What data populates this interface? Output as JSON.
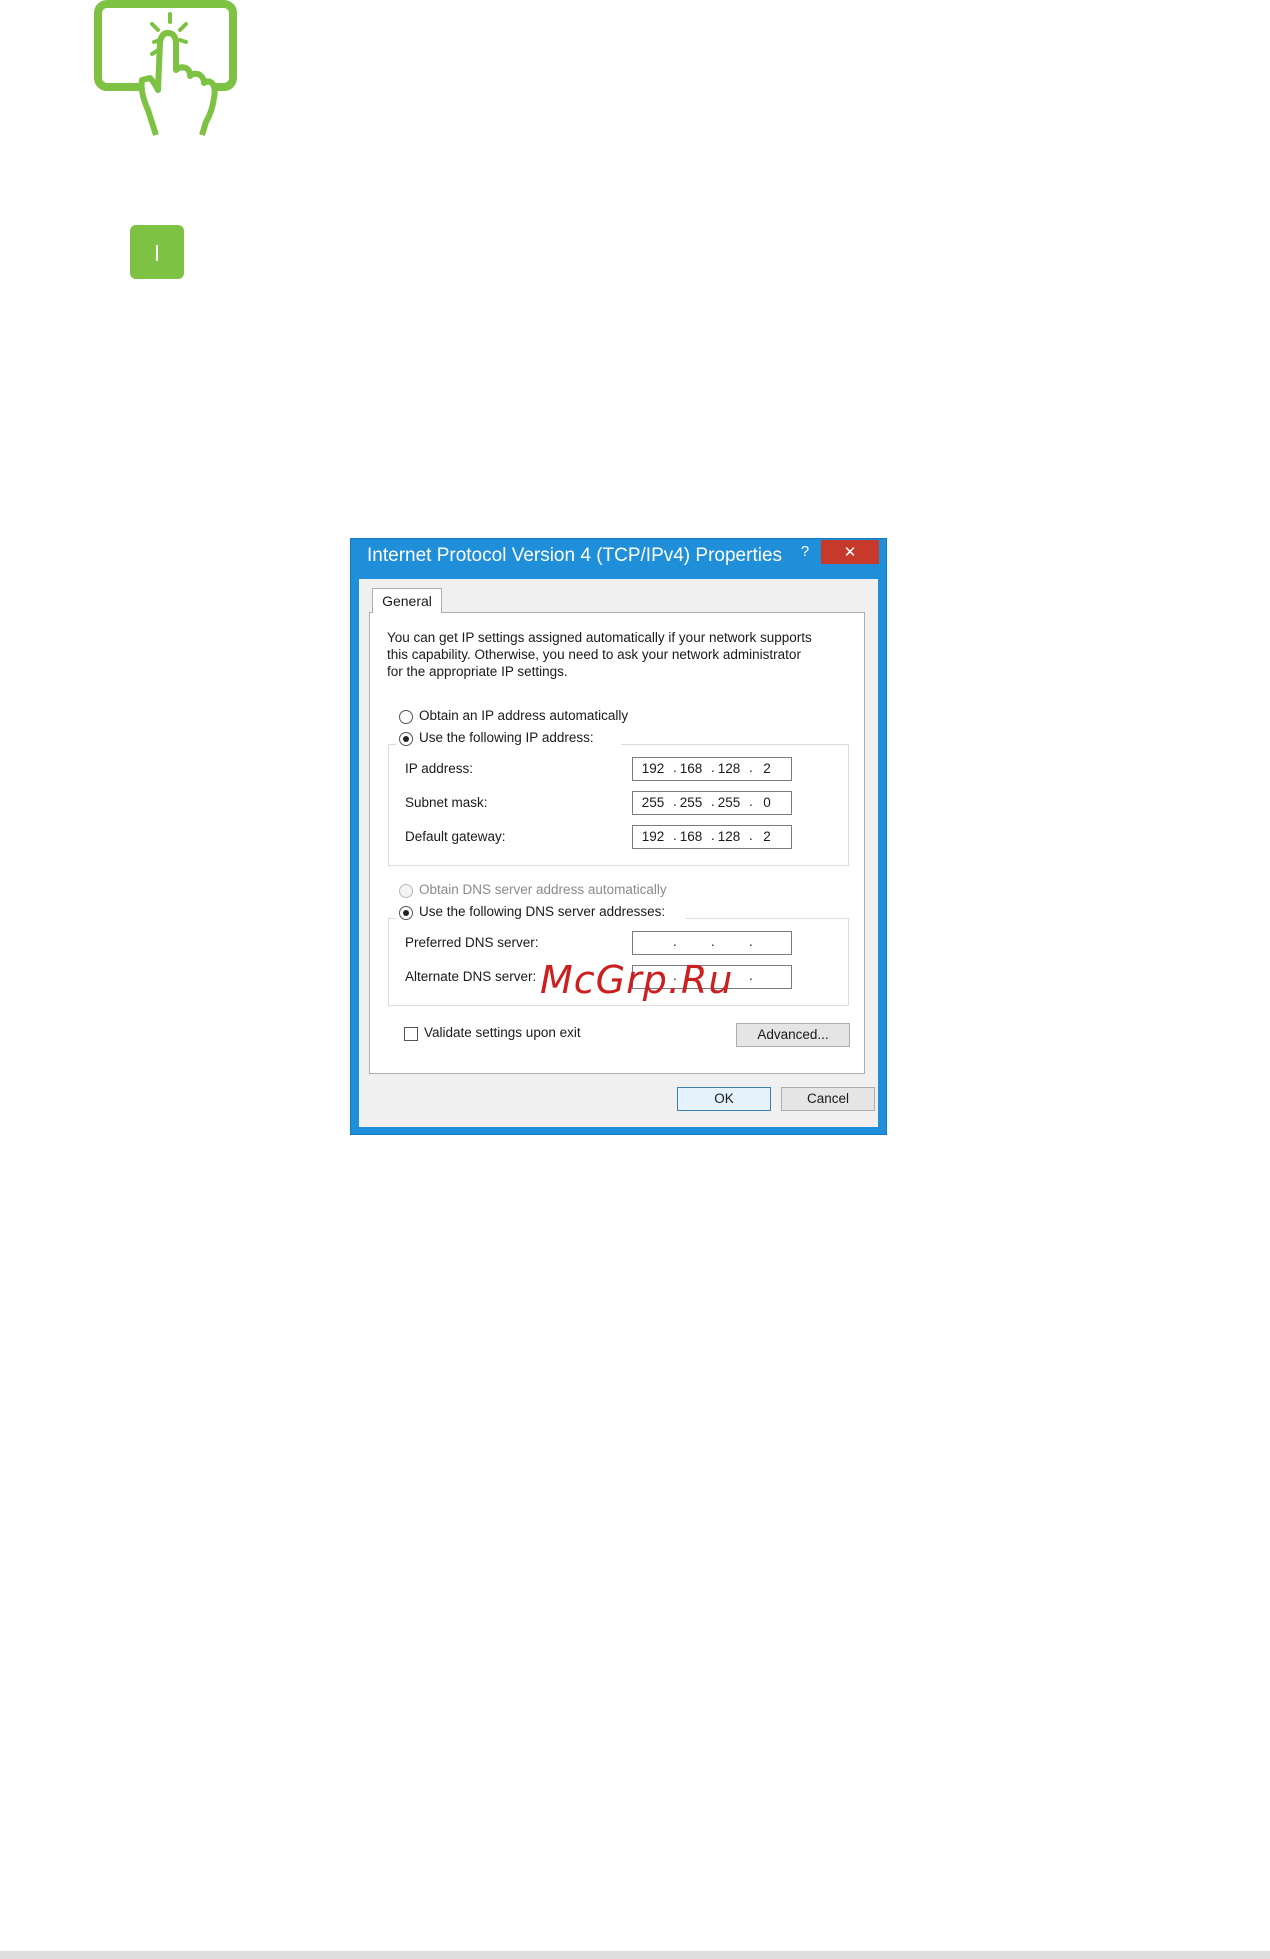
{
  "step_badge": {
    "text": "l"
  },
  "dialog": {
    "title": "Internet Protocol Version 4 (TCP/IPv4) Properties",
    "help_label": "?",
    "close_label": "✕",
    "tab_label": "General",
    "intro_text": "You can get IP settings assigned automatically if your network supports\nthis capability. Otherwise, you need to ask your network administrator\nfor the appropriate IP settings.",
    "ip_auto_label": "Obtain an IP address automatically",
    "ip_manual_label": "Use the following IP address:",
    "ip_mode": "manual",
    "ip_fields": [
      {
        "label": "IP address:",
        "octets": [
          "192",
          "168",
          "128",
          "2"
        ]
      },
      {
        "label": "Subnet mask:",
        "octets": [
          "255",
          "255",
          "255",
          "0"
        ]
      },
      {
        "label": "Default gateway:",
        "octets": [
          "192",
          "168",
          "128",
          "2"
        ]
      }
    ],
    "dns_auto_label": "Obtain DNS server address automatically",
    "dns_manual_label": "Use the following DNS server addresses:",
    "dns_mode": "manual",
    "dns_fields": [
      {
        "label": "Preferred DNS server:",
        "octets": [
          "",
          "",
          "",
          ""
        ]
      },
      {
        "label": "Alternate DNS server:",
        "octets": [
          "",
          "",
          "",
          ""
        ]
      }
    ],
    "validate_label": "Validate settings upon exit",
    "validate_checked": false,
    "advanced_label": "Advanced...",
    "ok_label": "OK",
    "cancel_label": "Cancel"
  },
  "watermark": "McGrp.Ru",
  "colors": {
    "accent_green": "#7dc242",
    "title_bar_blue": "#1e8fd8",
    "close_red": "#c7392b",
    "watermark_red": "#cc1f1f"
  },
  "icons": {
    "touch": "tap-gesture-icon"
  }
}
